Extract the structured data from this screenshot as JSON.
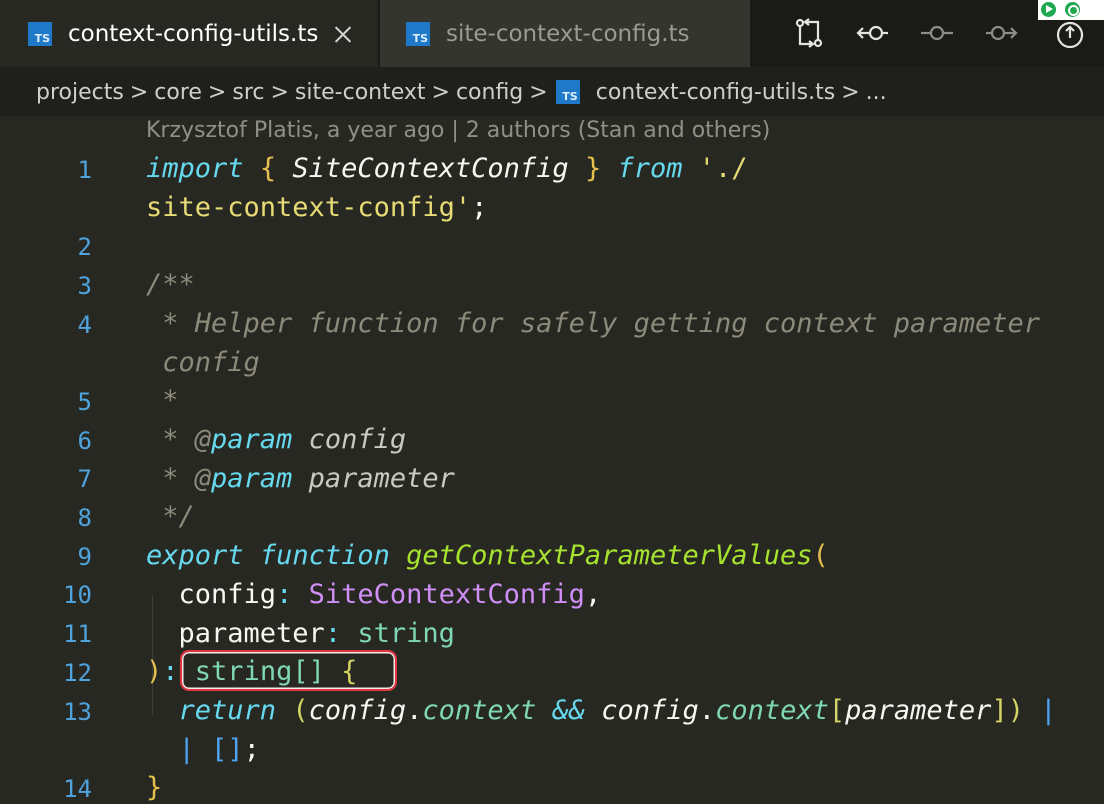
{
  "tabs": [
    {
      "label": "context-config-utils.ts",
      "icon": "ts-file-icon",
      "active": true
    },
    {
      "label": "site-context-config.ts",
      "icon": "ts-file-icon",
      "active": false
    }
  ],
  "ts_icon_text": "TS",
  "toolbar": {
    "icons": [
      "compare-changes-icon",
      "previous-change-icon",
      "current-change-icon",
      "next-change-icon",
      "git-history-icon"
    ]
  },
  "breadcrumb": {
    "items": [
      "projects",
      "core",
      "src",
      "site-context",
      "config",
      "context-config-utils.ts"
    ],
    "separator": ">",
    "overflow": "..."
  },
  "blame": "Krzysztof Platis, a year ago | 2 authors (Stan and others)",
  "code_lines": {
    "ln1": "1",
    "ln2": "2",
    "ln3": "3",
    "ln4": "4",
    "ln5": "5",
    "ln6": "6",
    "ln7": "7",
    "ln8": "8",
    "ln9": "9",
    "ln10": "10",
    "ln11": "11",
    "ln12": "12",
    "ln13": "13",
    "ln14": "14"
  },
  "code": {
    "l1_import": "import",
    "l1_brace_open": "{",
    "l1_name": "SiteContextConfig",
    "l1_brace_close": "}",
    "l1_from": "from",
    "l1_path_a": "'./",
    "l1_path_b": "site-context-config'",
    "l1_semi": ";",
    "l3": "/**",
    "l4a": " * Helper function for safely getting context parameter",
    "l4b": " config",
    "l5": " *",
    "l6_star": " * @",
    "l6_tag": "param",
    "l6_name": "config",
    "l7_star": " * @",
    "l7_tag": "param",
    "l7_name": "parameter",
    "l8": " */",
    "l9_export": "export",
    "l9_function": "function",
    "l9_name": "getContextParameterValues",
    "l9_paren": "(",
    "l10_name": "config",
    "l10_colon": ":",
    "l10_type": "SiteContextConfig",
    "l10_comma": ",",
    "l11_name": "parameter",
    "l11_colon": ":",
    "l11_type": "string",
    "l12_paren": ")",
    "l12_colon": ":",
    "l12_type": "string[]",
    "l12_brace": "{",
    "l13_return": "return",
    "l13_open": "(",
    "l13_config1": "config",
    "l13_dot1": ".",
    "l13_context1": "context",
    "l13_and": "&&",
    "l13_config2": "config",
    "l13_dot2": ".",
    "l13_context2": "context",
    "l13_bracket_open": "[",
    "l13_param": "parameter",
    "l13_bracket_close": "]",
    "l13_close": ")",
    "l13_pipe": "|",
    "l13b_pipe": "|",
    "l13b_arr": "[]",
    "l13b_semi": ";",
    "l14_brace": "}"
  },
  "colors": {
    "keyword": "#66d9ef",
    "function": "#a6e22e",
    "string": "#e6db74",
    "comment": "#8c8a7a",
    "highlight_border": "#e2343f"
  }
}
